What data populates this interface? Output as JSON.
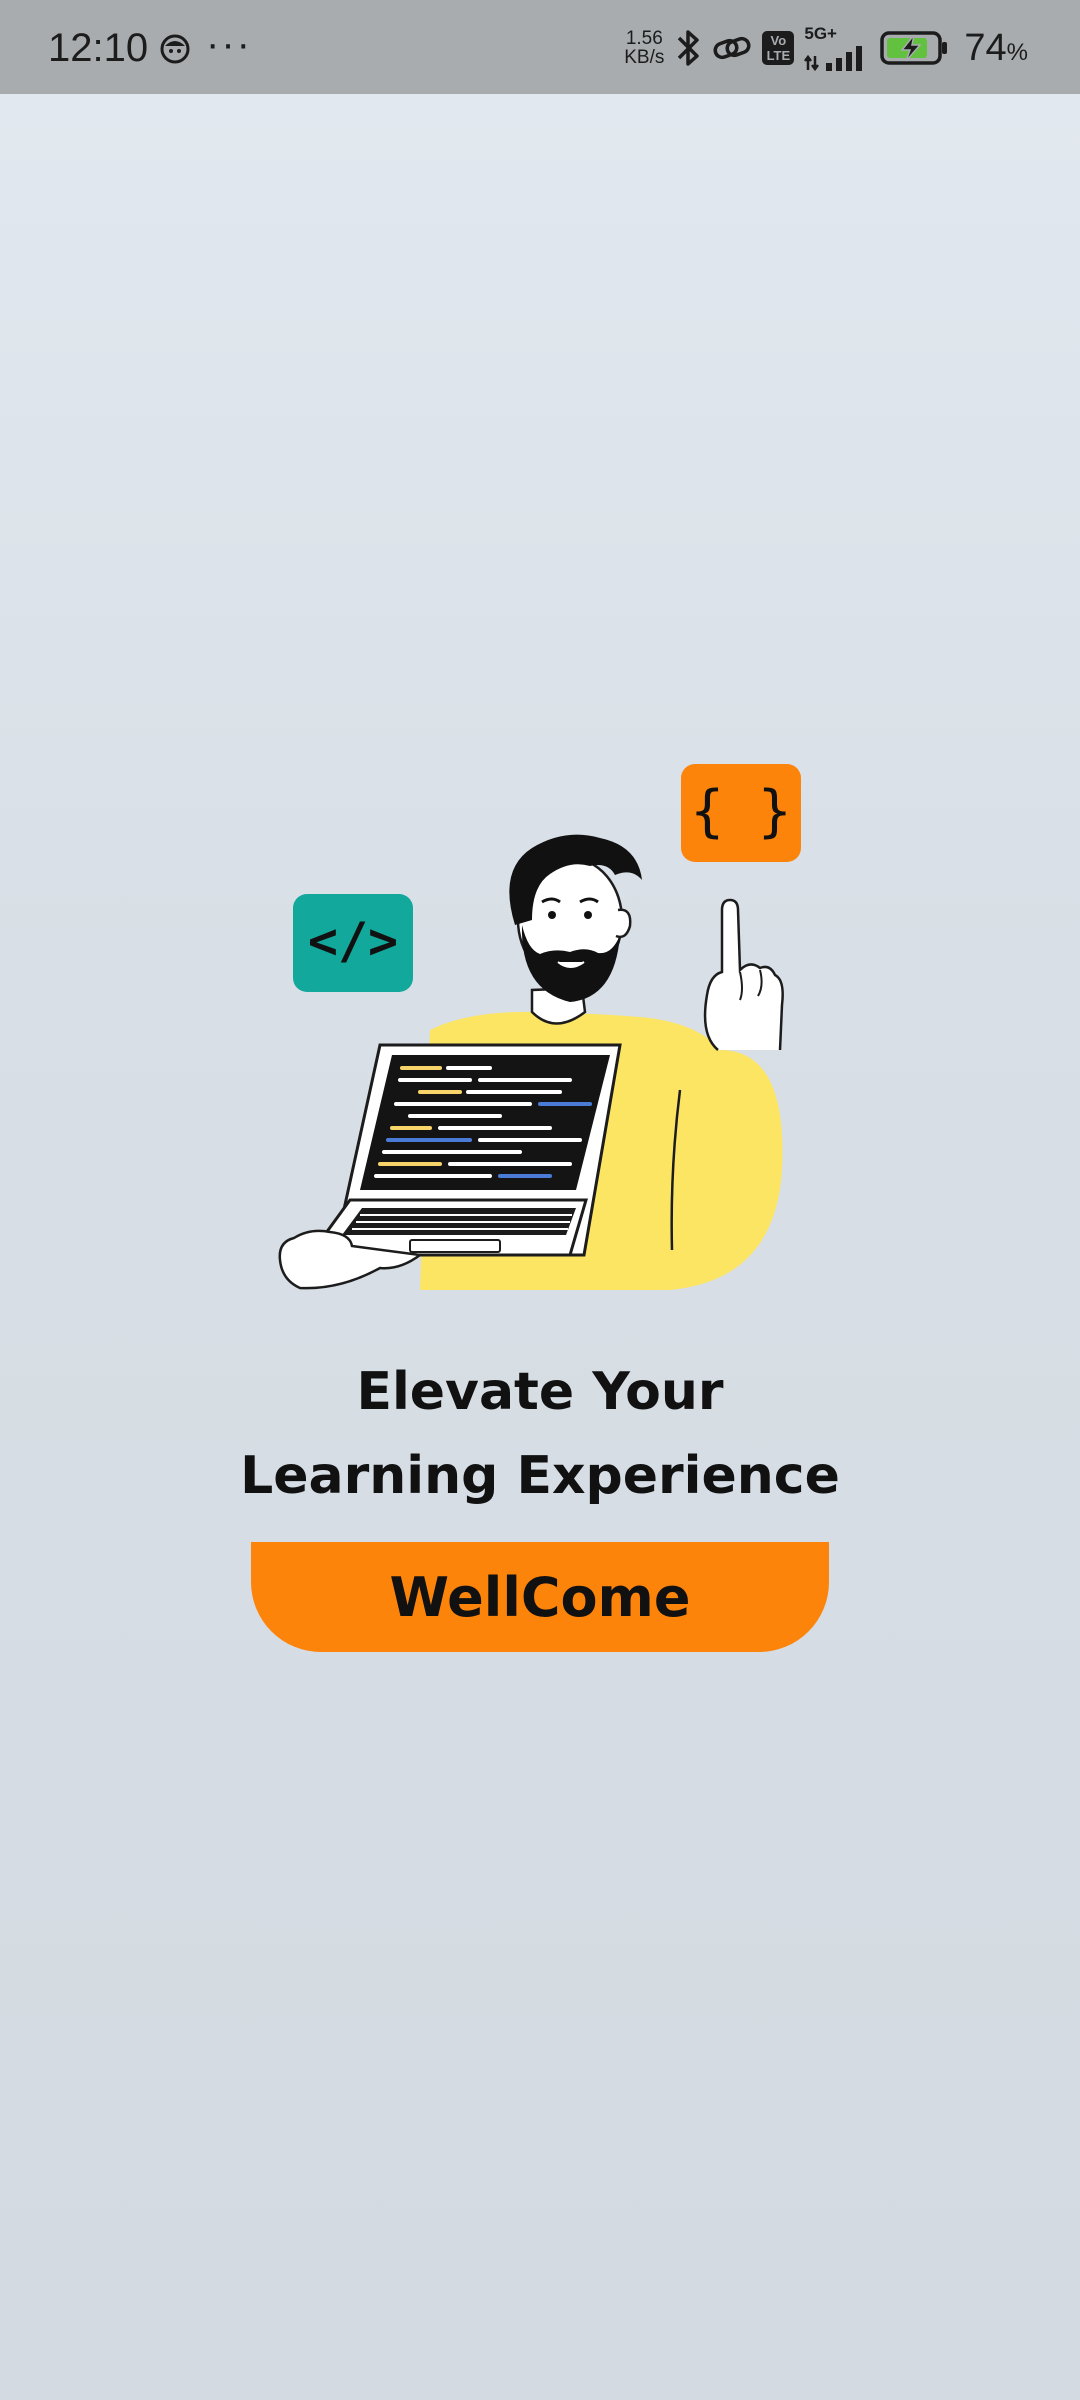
{
  "status_bar": {
    "time": "12:10",
    "more": "···",
    "net_speed_value": "1.56",
    "net_speed_unit": "KB/s",
    "network_type": "5G+",
    "volte": "Vo LTE",
    "battery_percent": "74",
    "battery_percent_sign": "%",
    "icons": [
      "app-notification-icon",
      "bluetooth-icon",
      "link-icon",
      "volte-icon",
      "signal-icon",
      "battery-charging-icon"
    ]
  },
  "hero": {
    "code_tag_badge": "</>",
    "braces_badge": "{ }",
    "badge_colors": {
      "code": "#12a89b",
      "braces": "#fd840a"
    },
    "sweater_color": "#fde564"
  },
  "headline": {
    "line1": "Elevate Your",
    "line2": "Learning Experience"
  },
  "welcome_button": {
    "label": "WellCome",
    "color": "#fd840a"
  }
}
